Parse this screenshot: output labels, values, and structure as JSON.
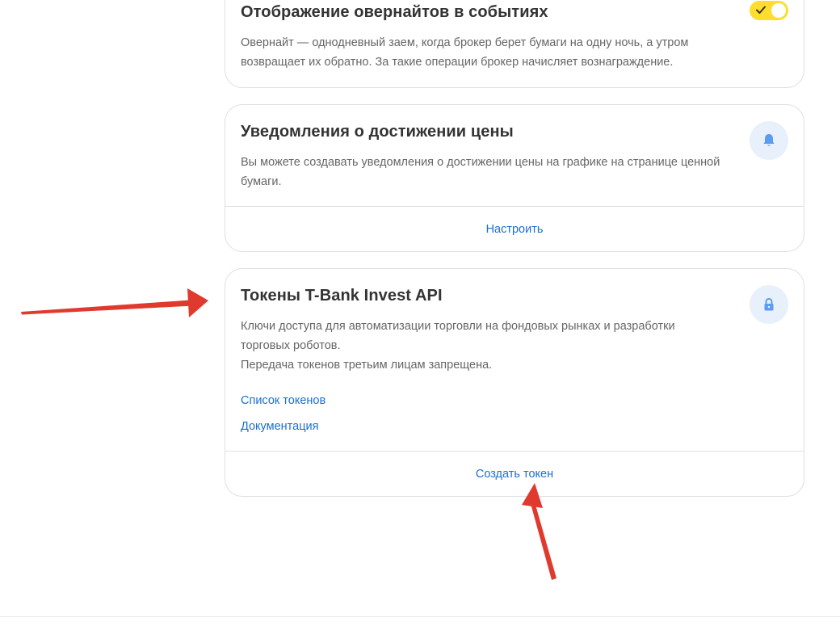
{
  "overnight_card": {
    "title": "Отображение овернайтов в событиях",
    "description": "Овернайт — однодневный заем, когда брокер берет бумаги на одну ночь, а  утром возвращает их обратно. За такие операции брокер начисляет вознаграждение.",
    "toggle_state": "on",
    "toggle_icon": "check-icon"
  },
  "price_alerts_card": {
    "title": "Уведомления о достижении цены",
    "description": "Вы можете создавать уведомления о достижении цены на графике на странице ценной бумаги.",
    "icon": "bell-icon",
    "action_label": "Настроить"
  },
  "tokens_card": {
    "title": "Токены T-Bank Invest API",
    "description_line1": "Ключи доступа для автоматизации торговли на фондовых рынках и разработки торговых роботов.",
    "description_line2": "Передача токенов третьим лицам запрещена.",
    "icon": "lock-icon",
    "links": {
      "token_list": "Список токенов",
      "documentation": "Документация"
    },
    "action_label": "Создать токен"
  },
  "colors": {
    "accent_link": "#1a6fd4",
    "toggle_on": "#ffdd2d",
    "icon_bg": "#e8f0fb",
    "icon_fg": "#5b9cf0",
    "annotation_arrow": "#e03a2f"
  }
}
